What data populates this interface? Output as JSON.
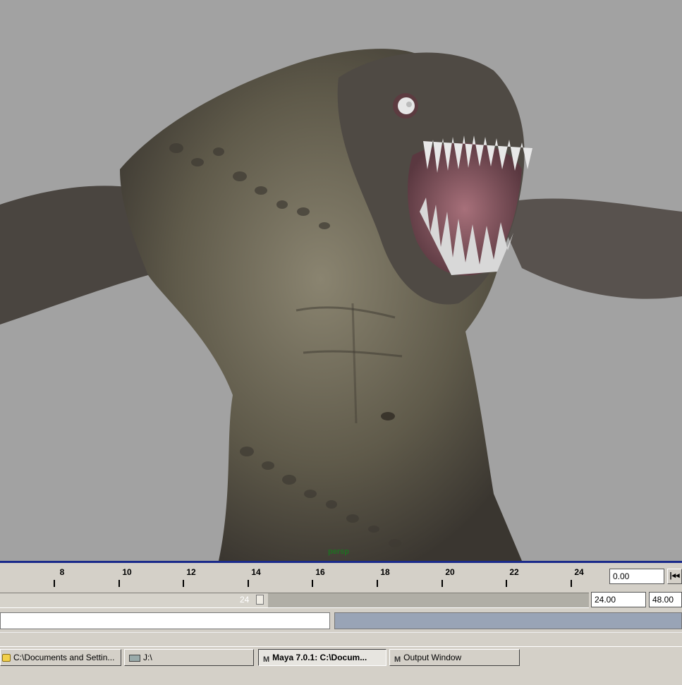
{
  "viewport": {
    "camera_label": "persp",
    "background_color": "#a2a2a2"
  },
  "timeslider": {
    "tick_labels": [
      "8",
      "10",
      "12",
      "14",
      "16",
      "18",
      "20",
      "22",
      "24"
    ],
    "current_time": "0.00",
    "step_back_icon": "step-back-icon"
  },
  "range_slider": {
    "bar_label": "24",
    "range_end": "24.00",
    "animation_end": "48.00"
  },
  "taskbar": {
    "items": [
      {
        "label": "C:\\Documents and Settin...",
        "icon": "folder-icon",
        "active": false
      },
      {
        "label": "J:\\",
        "icon": "drive-icon",
        "active": false
      },
      {
        "label": "Maya 7.0.1: C:\\Docum...",
        "icon": "maya-icon",
        "active": true
      },
      {
        "label": "Output Window",
        "icon": "maya-icon",
        "active": false
      }
    ]
  },
  "colors": {
    "panel": "#d4d0c8",
    "viewport_border": "#1a2a8a",
    "camera_label": "#1f6f22"
  }
}
